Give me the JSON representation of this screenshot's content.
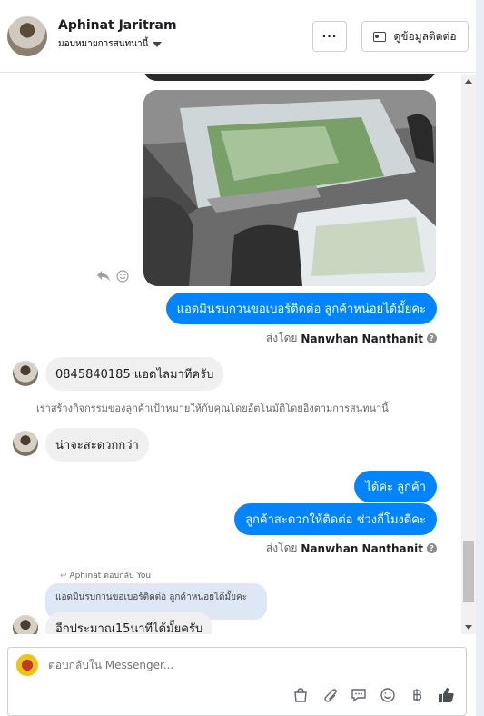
{
  "header": {
    "name": "Aphinat Jaritram",
    "assign_label": "มอบหมายการสนทนานี้",
    "more_label": "···",
    "info_button_label": "ดูข้อมูลติดต่อ"
  },
  "messages": {
    "out1": "แอดมินรบกวนขอเบอร์ติดต่อ ลูกค้าหน่อยได้มั้ยคะ",
    "sent_by_prefix": "ส่งโดย",
    "sent_by_name": "Nanwhan Nanthanit",
    "in1": "0845840185 แอดไลมาทีครับ",
    "system_note": "เราสร้างกิจกรรมของลูกค้าเป้าหมายให้กับคุณโดยอัตโนมัติโดยอิงตามการสนทนานี้",
    "in2": "น่าจะสะดวกกว่า",
    "out2": "ได้ค่ะ ลูกค้า",
    "out3": "ลูกค้าสะดวกให้ติดต่อ ช่วงกี่โมงดีคะ",
    "reply_label": "Aphinat ตอบกลับ You",
    "reply_quote": "แอดมินรบกวนขอเบอร์ติดต่อ ลูกค้าหน่อยได้มั้ยคะ",
    "in3": "อีกประมาณ15นาทีได้มั้ยครับ"
  },
  "composer": {
    "placeholder": "ตอบกลับใน Messenger..."
  },
  "icons": {
    "reply": "reply-icon",
    "emoji": "smiley-icon",
    "help": "?",
    "tools": [
      "bag-icon",
      "paperclip-icon",
      "speech-bubble-icon",
      "emoji-icon",
      "baht-icon",
      "thumbs-up-icon"
    ]
  },
  "colors": {
    "outgoing_bubble": "#0084ff",
    "incoming_bubble": "#f0f0f0",
    "reply_quote_bg": "#dde7f5"
  }
}
